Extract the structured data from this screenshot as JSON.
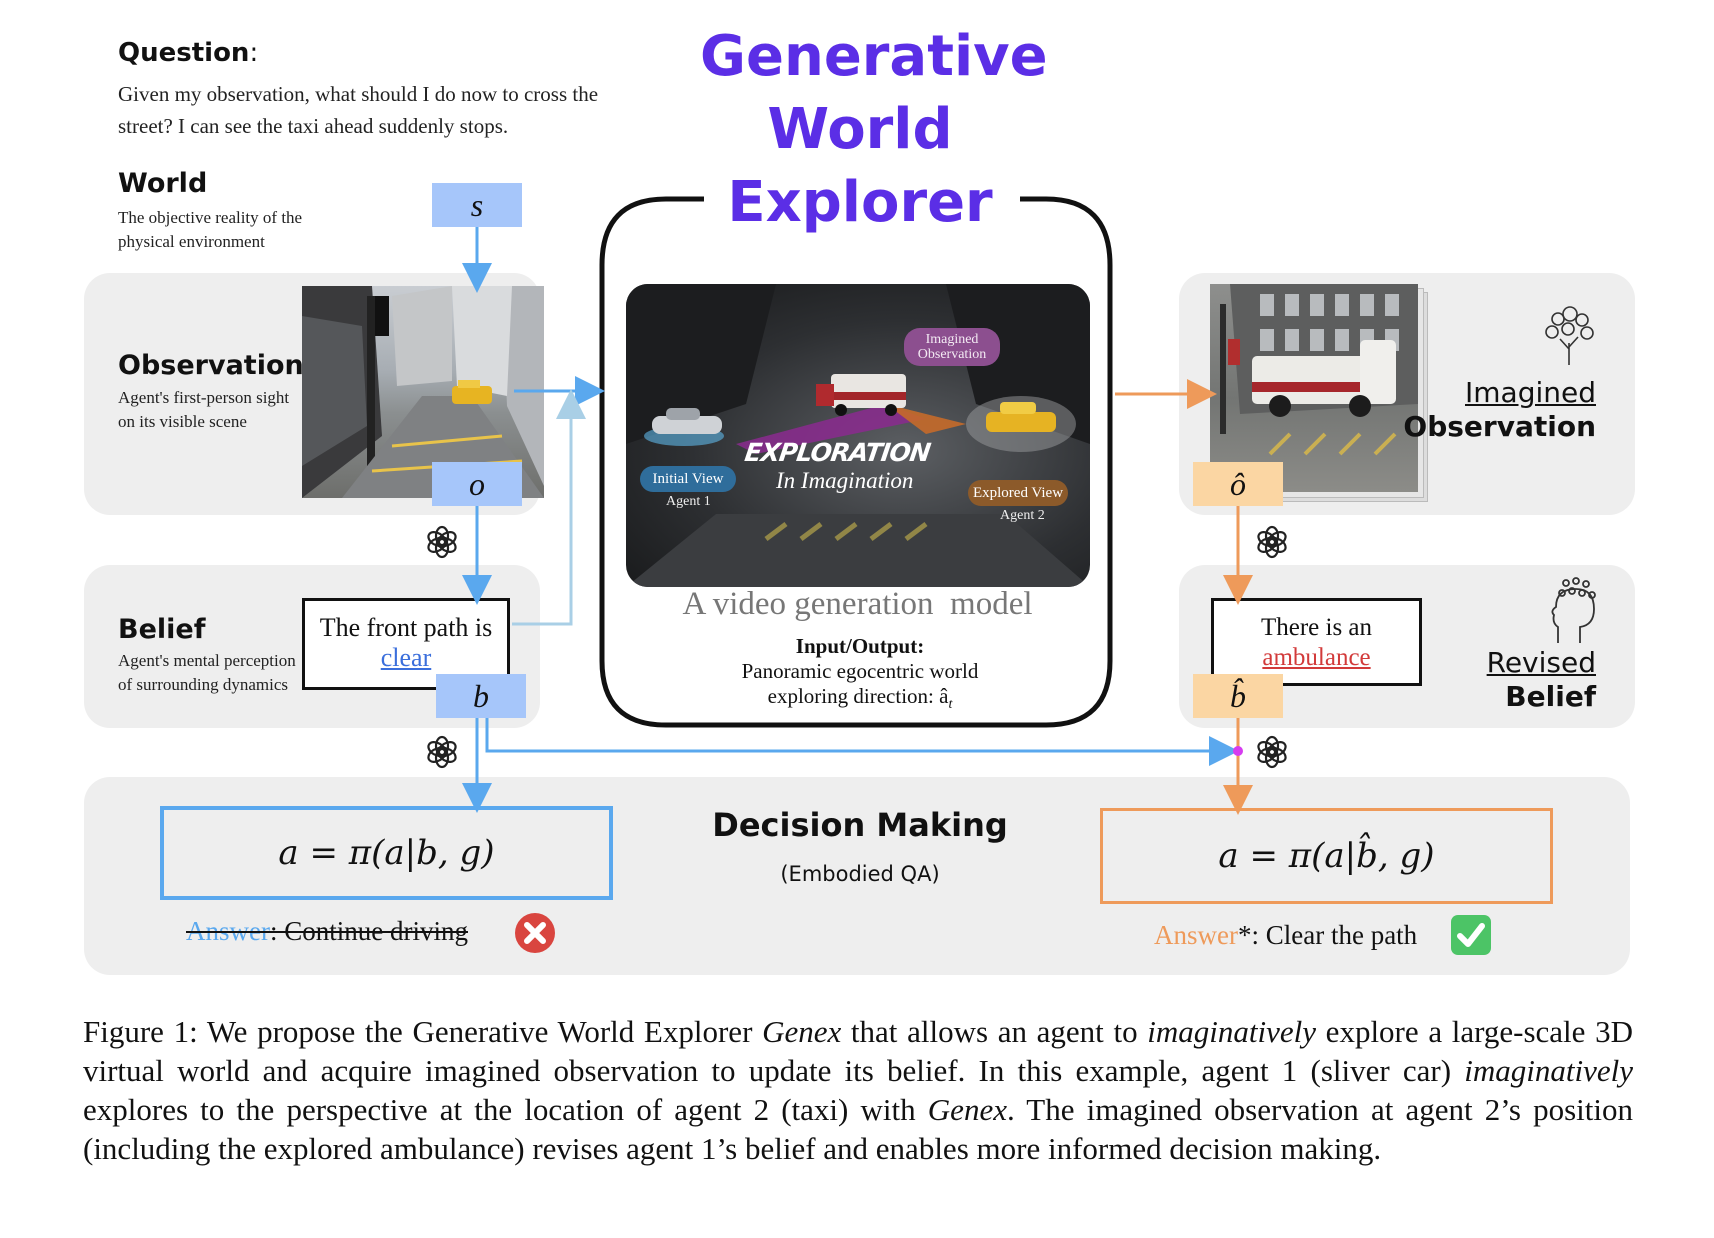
{
  "question": {
    "label": "Question",
    "text": "Given my observation, what should I do now to cross the street? I can see the taxi ahead suddenly stops."
  },
  "title": {
    "line1": "Generative",
    "line2": "World",
    "line3": "Explorer"
  },
  "world": {
    "label": "World",
    "desc": "The objective reality of the physical environment",
    "var": "s"
  },
  "observation": {
    "label": "Observation",
    "desc": "Agent's first-person sight on its visible scene",
    "var": "o"
  },
  "belief": {
    "label": "Belief",
    "desc": "Agent's mental perception of surrounding dynamics",
    "box_text_prefix": "The front path is ",
    "box_text_highlight": "clear",
    "var": "b"
  },
  "video_model": {
    "imagined_obs_tag": "Imagined Observation",
    "exploration_text": "EXPLORATION",
    "imagination_text": "In Imagination",
    "initial_view": "Initial View",
    "agent1": "Agent 1",
    "explored_view": "Explored View",
    "agent2": "Agent 2",
    "caption": "A video generation  model",
    "io_label": "Input/Output:",
    "io_line1": "Panoramic egocentric world",
    "io_line2": "exploring direction: â",
    "io_sub": "t"
  },
  "imagined": {
    "label_line1": "Imagined",
    "label_line2": "Observation",
    "var": "ô"
  },
  "revised": {
    "label_line1": "Revised",
    "label_line2": "Belief",
    "box_text_prefix": "There is an",
    "box_text_highlight": "ambulance",
    "var": "b̂"
  },
  "decision": {
    "title": "Decision Making",
    "subtitle": "(Embodied QA)",
    "left_formula_pre": "a = π(a|",
    "left_formula_var": "b",
    "left_formula_post": ", g)",
    "right_formula_pre": "a = π(a|",
    "right_formula_var": "b̂",
    "right_formula_post": ", g)",
    "left_answer_label": "Answer",
    "left_answer_text": ": Continue driving",
    "right_answer_label": "Answer",
    "right_answer_text": "*: Clear the path"
  },
  "caption": {
    "p1": "Figure 1:  We propose the Generative World Explorer ",
    "i1": "Genex",
    "p2": " that allows an agent to ",
    "i2": "imaginatively",
    "p3": " explore a large-scale 3D virtual world and acquire imagined observation to update its belief.  In this example, agent 1 (sliver car) ",
    "i3": "imaginatively",
    "p4": " explores to the perspective at the location of agent 2 (taxi) with ",
    "i4": "Genex",
    "p5": ". The imagined observation at agent 2’s position (including the explored ambulance) revises agent 1’s belief and enables more informed decision making."
  },
  "colors": {
    "title_purple": "#5b2ee6",
    "blue": "#5aa8ee",
    "orange": "#ee9a5a",
    "var_blue_bg": "#a6c6fa",
    "var_orange_bg": "#fbd6a3",
    "panel_gray": "#eeeeee",
    "wrong_red": "#d9453f",
    "right_green": "#4cc466"
  },
  "icons": [
    "openai-logo-icon",
    "wrong-x-icon",
    "check-icon",
    "brain-tree-icon",
    "head-swirl-icon",
    "arrow-icon"
  ]
}
